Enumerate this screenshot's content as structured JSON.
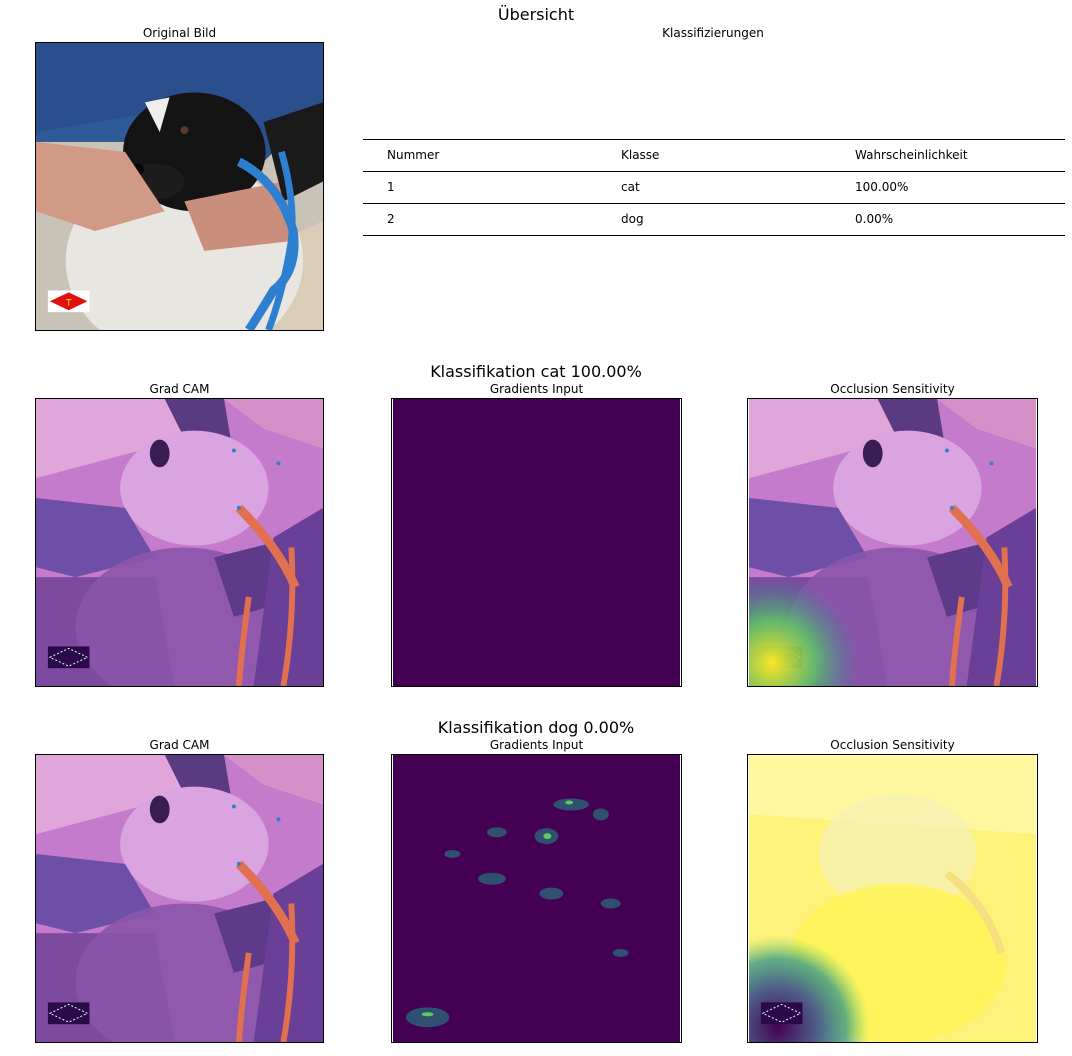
{
  "section1": {
    "title": "Übersicht",
    "original_title": "Original Bild",
    "classif_title": "Klassifizierungen"
  },
  "chart_data": {
    "type": "table",
    "columns": [
      "Nummer",
      "Klasse",
      "Wahrscheinlichkeit"
    ],
    "rows": [
      [
        "1",
        "cat",
        "100.00%"
      ],
      [
        "2",
        "dog",
        "0.00%"
      ]
    ]
  },
  "rows": [
    {
      "title": "Klassifikation cat 100.00%",
      "panels": [
        "Grad CAM",
        "Gradients Input",
        "Occlusion Sensitivity"
      ]
    },
    {
      "title": "Klassifikation dog 0.00%",
      "panels": [
        "Grad CAM",
        "Gradients Input",
        "Occlusion Sensitivity"
      ]
    }
  ],
  "colors": {
    "viridis_dark": "#440154",
    "viridis_yellow": "#fde725",
    "viridis_teal": "#21918c",
    "viridis_green": "#5ec962",
    "overlay_pink": "#d78bd6",
    "overlay_purple": "#7a4aa0",
    "leash_blue": "#2f7fd0",
    "leash_orange": "#e07050"
  }
}
